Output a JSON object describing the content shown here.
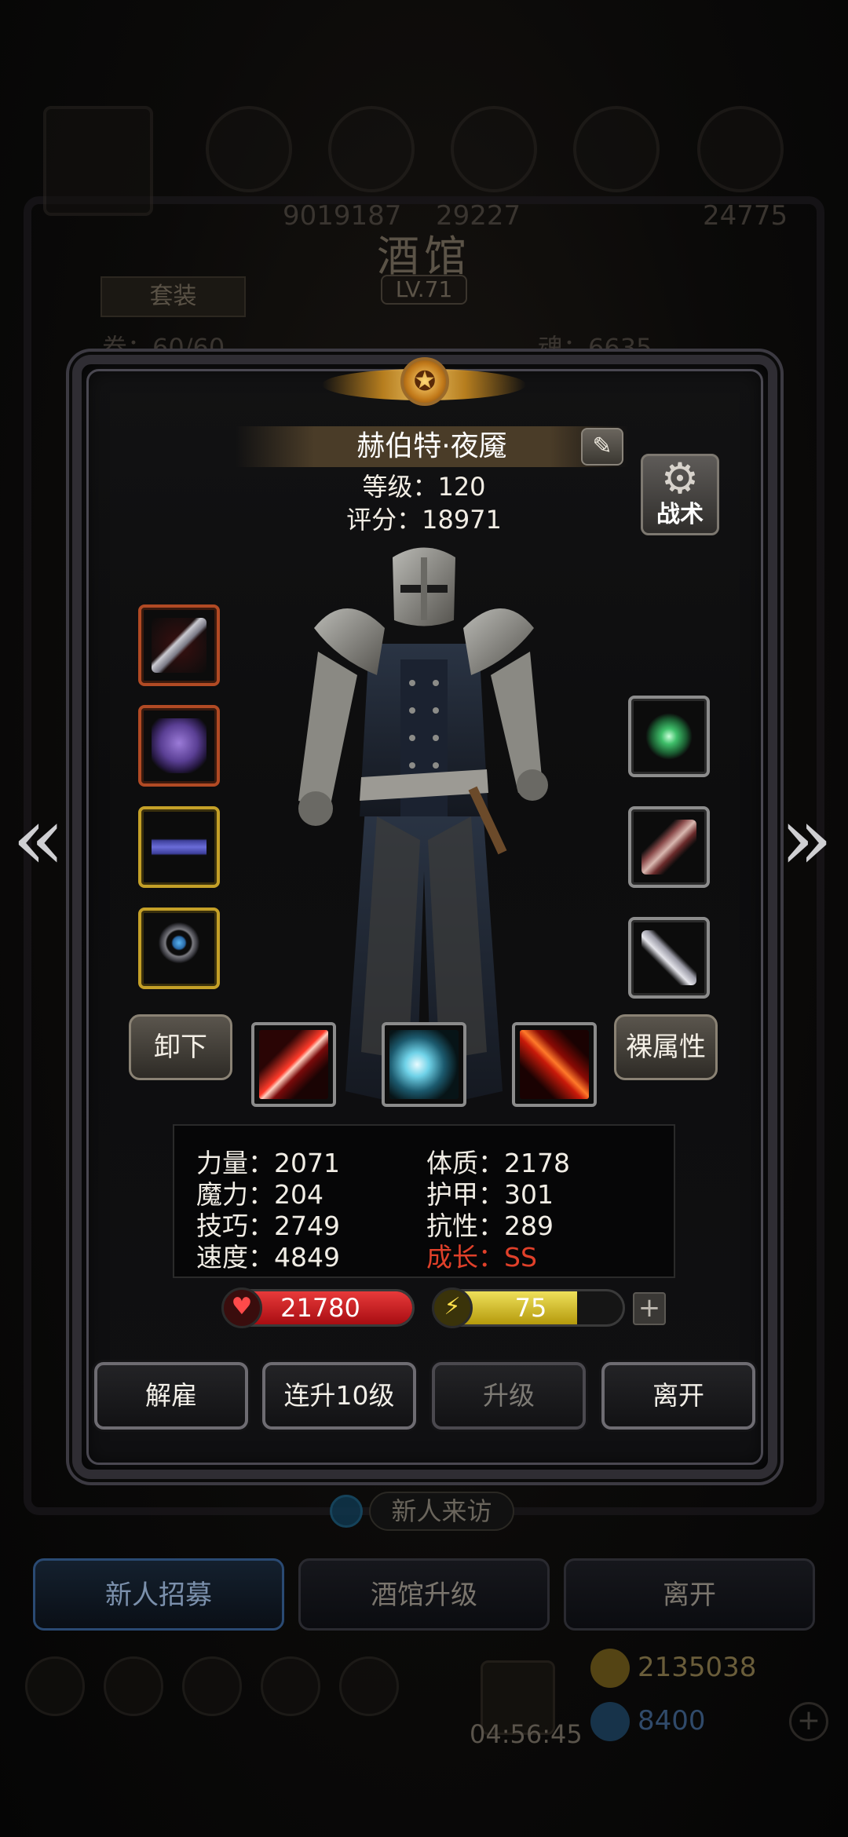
{
  "background": {
    "title": "酒馆",
    "level_badge": "LV.71",
    "tab_label": "套装",
    "stat_left": "卷：60/60",
    "stat_right": "魂：6635",
    "hud_left": "9019187",
    "hud_mid": "29227",
    "hud_right": "24775",
    "visit_label": "新人来访",
    "bottom_buttons": [
      "新人招募",
      "酒馆升级",
      "离开"
    ],
    "gold": "2135038",
    "gems": "8400",
    "timer": "04:56:45"
  },
  "hero": {
    "name": "赫伯特·夜魇",
    "level_label": "等级：120",
    "score_label": "评分：18971",
    "tactics_label": "战术"
  },
  "equipment": {
    "left": [
      {
        "icon": "dagger-icon",
        "rarity": "red"
      },
      {
        "icon": "armor-icon",
        "rarity": "red"
      },
      {
        "icon": "belt-icon",
        "rarity": "gold"
      },
      {
        "icon": "ring-icon",
        "rarity": "gold"
      }
    ],
    "right": [
      {
        "icon": "amulet-icon",
        "rarity": "gray"
      },
      {
        "icon": "feather-icon",
        "rarity": "gray"
      },
      {
        "icon": "knife-icon",
        "rarity": "gray"
      }
    ]
  },
  "controls": {
    "unequip": "卸下",
    "naked_attrs": "裸属性"
  },
  "skills": [
    {
      "icon": "slash-skill-icon",
      "color": "#c8201e"
    },
    {
      "icon": "wind-skill-icon",
      "color": "#3fa4b8"
    },
    {
      "icon": "fire-blade-skill-icon",
      "color": "#b81e10"
    }
  ],
  "attributes": {
    "strength": "力量：2071",
    "constitution": "体质：2178",
    "magic": "魔力：204",
    "armor": "护甲：301",
    "skill": "技巧：2749",
    "resistance": "抗性：289",
    "speed": "速度：4849",
    "growth": "成长：SS"
  },
  "vitals": {
    "hp": "21780",
    "energy": "75",
    "energy_fraction": 0.75
  },
  "actions": {
    "dismiss": "解雇",
    "level_up_10": "连升10级",
    "level_up": "升级",
    "leave": "离开"
  },
  "colors": {
    "hp": "#c3161c",
    "energy": "#c9b21a",
    "growth": "#e0402a"
  }
}
